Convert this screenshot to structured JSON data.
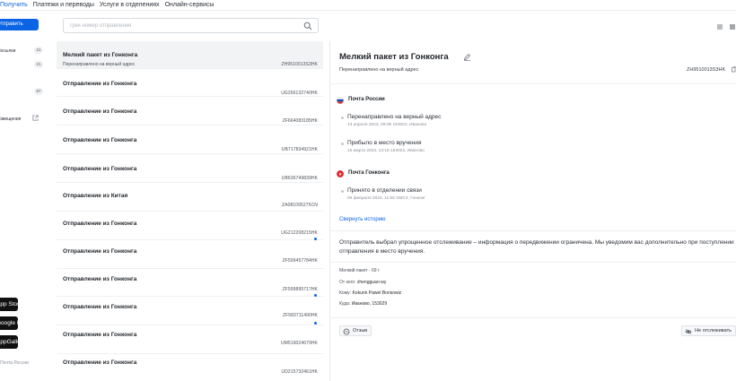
{
  "nav": {
    "tabs": [
      {
        "label": "Получить",
        "active": true
      },
      {
        "label": "Платежи и переводы",
        "active": false
      },
      {
        "label": "Услуги в отделениях",
        "active": false
      },
      {
        "label": "Онлайн-сервисы",
        "active": false
      }
    ]
  },
  "sidebar": {
    "send_label": "Отправить",
    "items": [
      {
        "label": "Посылки",
        "badge": "21"
      },
      {
        "label": "",
        "badge": "21"
      },
      {
        "label": "",
        "badge": "67"
      },
      {
        "label": "Извещения",
        "badge": ""
      }
    ],
    "stores": [
      "App Store",
      "Google Play",
      "AppGallery"
    ],
    "footer": "© Почта России"
  },
  "search": {
    "placeholder": "Трек-номер отправления",
    "value": ""
  },
  "shipments": [
    {
      "title": "Мелкий пакет из Гонконга",
      "status": "Перенаправлено на верный адрес",
      "track": "ZH9510013S3HK",
      "selected": true,
      "unread": false
    },
    {
      "title": "Отправление из Гонконга",
      "status": "",
      "track": "UG266132740HK",
      "selected": false,
      "unread": false
    },
    {
      "title": "Отправление из Гонконга",
      "status": "",
      "track": "ZF664083185HK",
      "selected": false,
      "unread": false
    },
    {
      "title": "Отправление из Гонконга",
      "status": "",
      "track": "UB717834921HK",
      "selected": false,
      "unread": false
    },
    {
      "title": "Отправление из Гонконга",
      "status": "",
      "track": "UB636749839HK",
      "selected": false,
      "unread": false
    },
    {
      "title": "Отправление из Китая",
      "status": "",
      "track": "ZA081095275CN",
      "selected": false,
      "unread": false
    },
    {
      "title": "Отправление из Гонконга",
      "status": "",
      "track": "UG212208215HK",
      "selected": false,
      "unread": true
    },
    {
      "title": "Отправление из Гонконга",
      "status": "",
      "track": "ZF599457784HK",
      "selected": false,
      "unread": false
    },
    {
      "title": "Отправление из Гонконга",
      "status": "",
      "track": "ZF599895717HK",
      "selected": false,
      "unread": true
    },
    {
      "title": "Отправление из Гонконга",
      "status": "",
      "track": "ZF583711490HK",
      "selected": false,
      "unread": true
    },
    {
      "title": "Отправление из Гонконга",
      "status": "",
      "track": "UM519024679HK",
      "selected": false,
      "unread": false
    },
    {
      "title": "Отправление из Гонконга",
      "status": "",
      "track": "UD215732461HK",
      "selected": false,
      "unread": false
    }
  ],
  "detail": {
    "title": "Мелкий пакет из Гонконга",
    "status": "Перенаправлено на верный адрес",
    "track": "ZH9510013S3HK",
    "carriers": [
      {
        "name": "Почта России",
        "flag": "ru",
        "events": [
          {
            "title": "Перенаправлено на верный адрес",
            "time": "13 апреля 2023, 09:05 153023, Иваново"
          },
          {
            "title": "Прибыло в место вручения",
            "time": "15 марта 2023, 13:16 153023, Иваново"
          }
        ]
      },
      {
        "name": "Почта Гонконга",
        "flag": "hk",
        "events": [
          {
            "title": "Принято в отделении связи",
            "time": "06 февраля 2023, 11:55 SMC3, Гонконг"
          }
        ]
      }
    ],
    "collapse_label": "Свернуть историю",
    "notice": "Отправитель выбрал упрощенное отслеживание – информация о передвижении ограничена. Мы уведомим вас дополнительно при поступлении отправления в место вручения.",
    "info": {
      "type": "Мелкий пакет · 69 г",
      "from_label": "От кого:",
      "from": "zhengguan-wy",
      "to_label": "Кому:",
      "to": "Kokurin Pawel Borisowiz",
      "where_label": "Куда:",
      "where": "Иваново, 153029"
    },
    "feedback_label": "Отзыв",
    "untrack_label": "Не отслеживать"
  },
  "colors": {
    "accent": "#0b63e5",
    "selected_row": "#f2f3f5",
    "hk_flag": "#e0262b"
  }
}
